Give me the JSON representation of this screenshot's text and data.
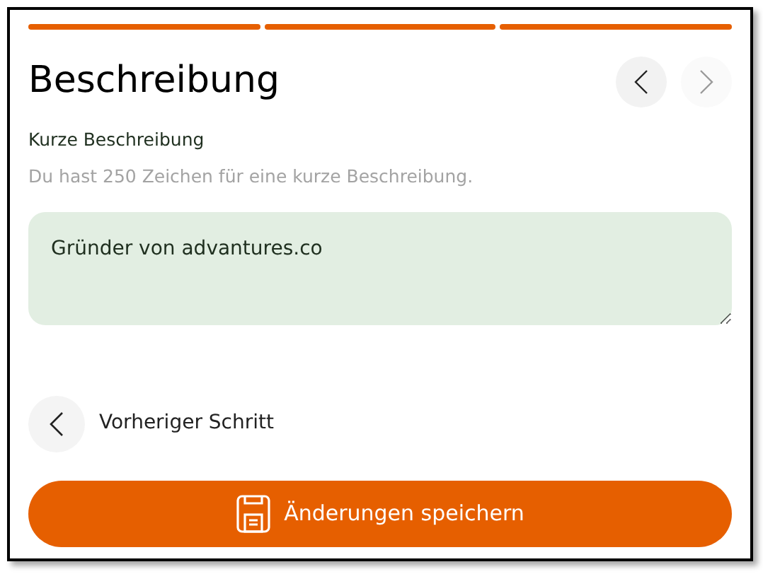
{
  "progress_steps": [
    {
      "completed": true
    },
    {
      "completed": true
    },
    {
      "completed": true
    }
  ],
  "title": "Beschreibung",
  "nav_buttons": [
    {
      "kind": "previous",
      "disabled": false
    },
    {
      "kind": "next",
      "disabled": true
    }
  ],
  "field": {
    "label": "Kurze Beschreibung",
    "hint": "Du hast 250 Zeichen für eine kurze Beschreibung.",
    "value": "Gründer von advantures.co"
  },
  "previous_step": {
    "label": "Vorheriger Schritt"
  },
  "save_button": {
    "label": "Änderungen speichern"
  }
}
